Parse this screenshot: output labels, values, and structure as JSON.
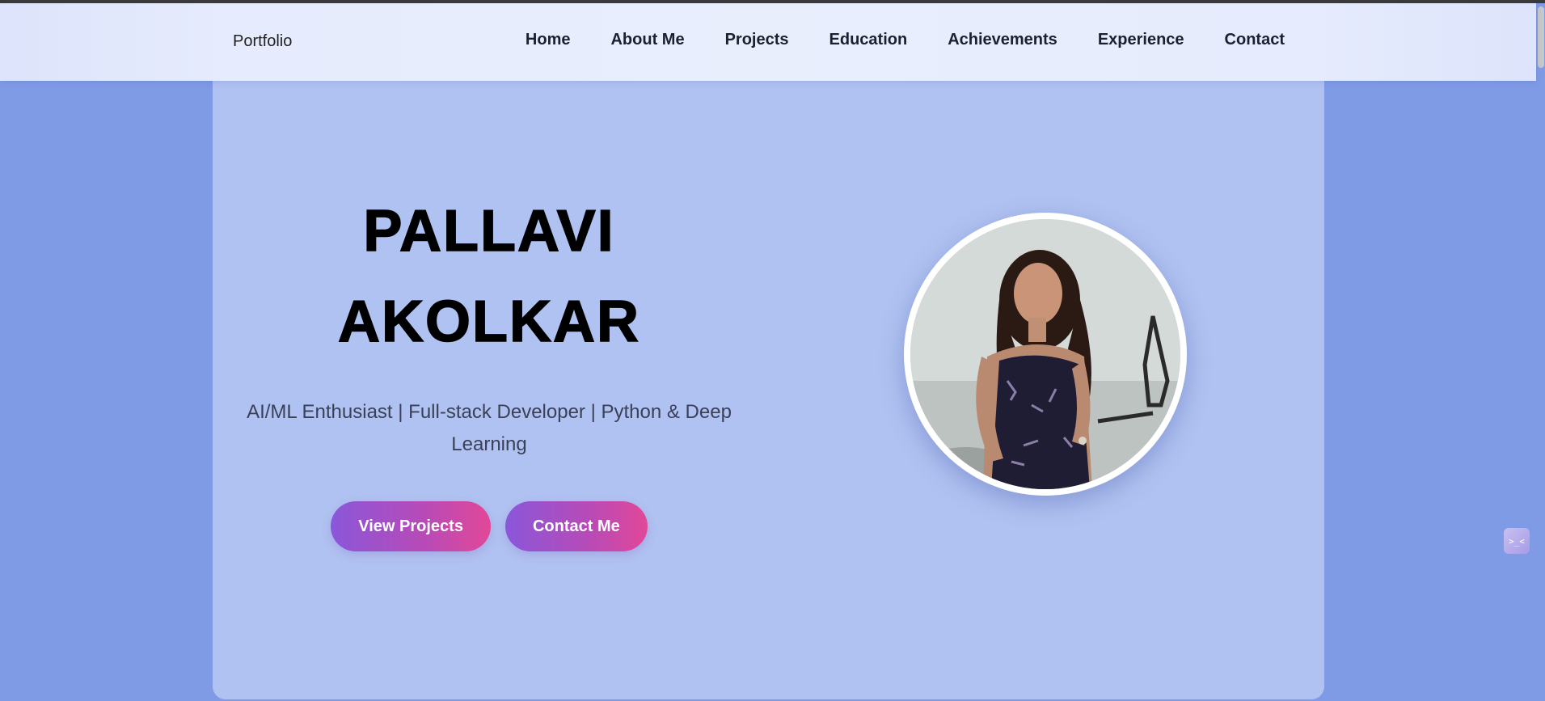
{
  "nav": {
    "brand": "Portfolio",
    "links": [
      "Home",
      "About Me",
      "Projects",
      "Education",
      "Achievements",
      "Experience",
      "Contact"
    ]
  },
  "hero": {
    "first_name": "PALLAVI",
    "last_name": "AKOLKAR",
    "tagline": "AI/ML Enthusiast | Full-stack Developer | Python & Deep Learning",
    "buttons": {
      "view_projects": "View Projects",
      "contact_me": "Contact Me"
    }
  },
  "widget": {
    "icon": "chat-face-icon",
    "glyph": ">_<"
  },
  "colors": {
    "page_background": "#7f9be6",
    "hero_card": "#b0c2f1",
    "navbar": "#e9eefd",
    "button_gradient_start": "#8a57da",
    "button_gradient_end": "#e24898"
  }
}
